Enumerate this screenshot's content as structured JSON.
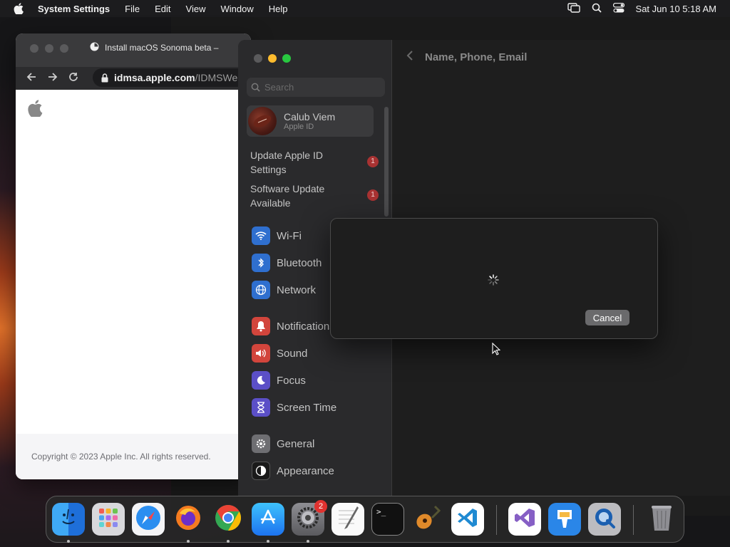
{
  "menubar": {
    "app_name": "System Settings",
    "menus": [
      "File",
      "Edit",
      "View",
      "Window",
      "Help"
    ],
    "clock": "Sat Jun 10  5:18 AM"
  },
  "browser": {
    "tab_title": "Install macOS Sonoma beta – ",
    "url_domain": "idmsa.apple.com",
    "url_path": "/IDMSWe",
    "footer": "Copyright © 2023 Apple Inc. All rights reserved."
  },
  "settings": {
    "search_placeholder": "Search",
    "account": {
      "name": "Calub Viem",
      "subtitle": "Apple ID"
    },
    "alerts": [
      {
        "label": "Update Apple ID Settings",
        "badge": "1"
      },
      {
        "label": "Software Update Available",
        "badge": "1"
      }
    ],
    "items": {
      "wifi": "Wi-Fi",
      "bluetooth": "Bluetooth",
      "network": "Network",
      "notifications": "Notifications",
      "sound": "Sound",
      "focus": "Focus",
      "screen_time": "Screen Time",
      "general": "General",
      "appearance": "Appearance"
    },
    "detail_title": "Name, Phone, Email",
    "sheet": {
      "cancel_label": "Cancel"
    }
  },
  "dock": {
    "apps": [
      "Finder",
      "Launchpad",
      "Safari",
      "Firefox",
      "Chrome",
      "App Store",
      "System Settings",
      "TextEdit",
      "Terminal",
      "GarageBand",
      "Visual Studio Code",
      "Visual Studio",
      "Keynote",
      "QuickTime Player",
      "Trash"
    ],
    "settings_badge": "2"
  },
  "colors": {
    "accent_red": "#ff5f57",
    "accent_yellow": "#febc2e",
    "accent_green": "#28c840",
    "badge_red": "#e0322f",
    "sidebar_bg": "#2a2a2c"
  }
}
